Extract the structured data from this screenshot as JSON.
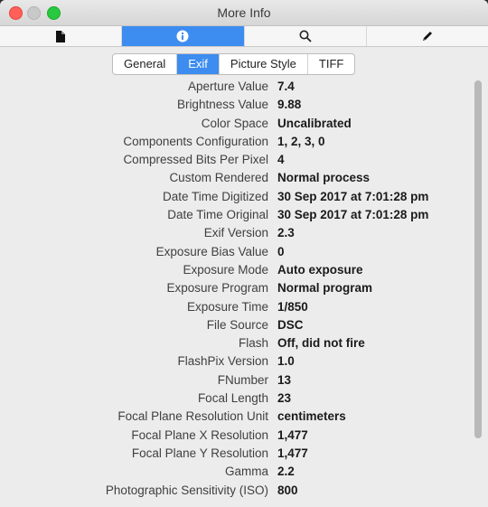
{
  "window": {
    "title": "More Info"
  },
  "toolbar": {
    "tools": [
      {
        "icon": "document-icon"
      },
      {
        "icon": "info-icon"
      },
      {
        "icon": "search-icon"
      },
      {
        "icon": "pencil-icon"
      }
    ]
  },
  "segments": [
    {
      "label": "General"
    },
    {
      "label": "Exif"
    },
    {
      "label": "Picture Style"
    },
    {
      "label": "TIFF"
    }
  ],
  "rows": [
    {
      "key": "Aperture Value",
      "value": "7.4"
    },
    {
      "key": "Brightness Value",
      "value": "9.88"
    },
    {
      "key": "Color Space",
      "value": "Uncalibrated"
    },
    {
      "key": "Components Configuration",
      "value": "1, 2, 3, 0"
    },
    {
      "key": "Compressed Bits Per Pixel",
      "value": "4"
    },
    {
      "key": "Custom Rendered",
      "value": "Normal process"
    },
    {
      "key": "Date Time Digitized",
      "value": "30 Sep 2017 at 7:01:28 pm"
    },
    {
      "key": "Date Time Original",
      "value": "30 Sep 2017 at 7:01:28 pm"
    },
    {
      "key": "Exif Version",
      "value": "2.3"
    },
    {
      "key": "Exposure Bias Value",
      "value": "0"
    },
    {
      "key": "Exposure Mode",
      "value": "Auto exposure"
    },
    {
      "key": "Exposure Program",
      "value": "Normal program"
    },
    {
      "key": "Exposure Time",
      "value": "1/850"
    },
    {
      "key": "File Source",
      "value": "DSC"
    },
    {
      "key": "Flash",
      "value": "Off, did not fire"
    },
    {
      "key": "FlashPix Version",
      "value": "1.0"
    },
    {
      "key": "FNumber",
      "value": "13"
    },
    {
      "key": "Focal Length",
      "value": "23"
    },
    {
      "key": "Focal Plane Resolution Unit",
      "value": "centimeters"
    },
    {
      "key": "Focal Plane X Resolution",
      "value": "1,477"
    },
    {
      "key": "Focal Plane Y Resolution",
      "value": "1,477"
    },
    {
      "key": "Gamma",
      "value": "2.2"
    },
    {
      "key": "Photographic Sensitivity (ISO)",
      "value": "800"
    }
  ],
  "colors": {
    "accent": "#3d8cf0",
    "close": "#ff5f57",
    "maximize": "#28c840"
  }
}
